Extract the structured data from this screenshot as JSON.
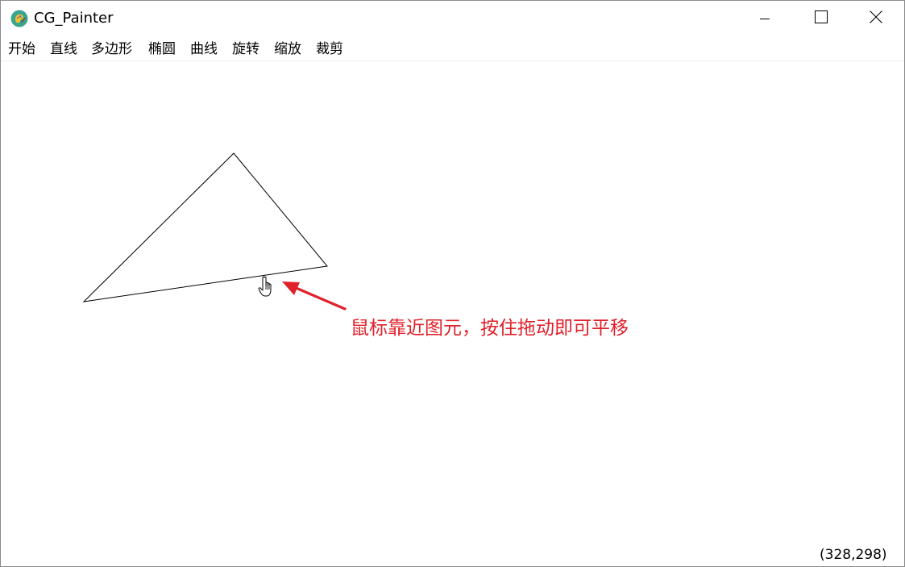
{
  "window": {
    "title": "CG_Painter",
    "app_icon": "palette-icon",
    "controls": {
      "minimize_icon": "minimize-icon",
      "maximize_icon": "maximize-icon",
      "close_icon": "close-icon"
    }
  },
  "menu": {
    "items": [
      {
        "label": "开始"
      },
      {
        "label": "直线"
      },
      {
        "label": "多边形"
      },
      {
        "label": "椭圆"
      },
      {
        "label": "曲线"
      },
      {
        "label": "旋转"
      },
      {
        "label": "缩放"
      },
      {
        "label": "裁剪"
      }
    ]
  },
  "canvas": {
    "shape": "triangle",
    "stroke_color": "#000000",
    "cursor_icon": "hand-pointer-icon",
    "annotation": {
      "text": "鼠标靠近图元，按住拖动即可平移",
      "color": "#e0202a"
    }
  },
  "status": {
    "coordinates": "(328,298)"
  }
}
